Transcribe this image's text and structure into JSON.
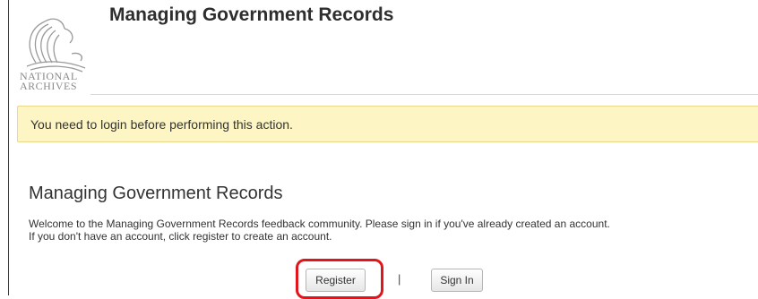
{
  "header": {
    "site_title": "Managing Government Records",
    "logo_line1": "NATIONAL",
    "logo_line2": "ARCHIVES"
  },
  "alert": {
    "message": "You need to login before performing this action."
  },
  "main": {
    "heading": "Managing Government Records",
    "welcome_line1": "Welcome to the Managing Government Records feedback community. Please sign in if you've already created an account.",
    "welcome_line2": "If you don't have an account, click register to create an account.",
    "register_label": "Register",
    "separator": "|",
    "signin_label": "Sign In"
  },
  "colors": {
    "alert_background": "#fdf6c4",
    "highlight_outline": "#e0161c"
  }
}
